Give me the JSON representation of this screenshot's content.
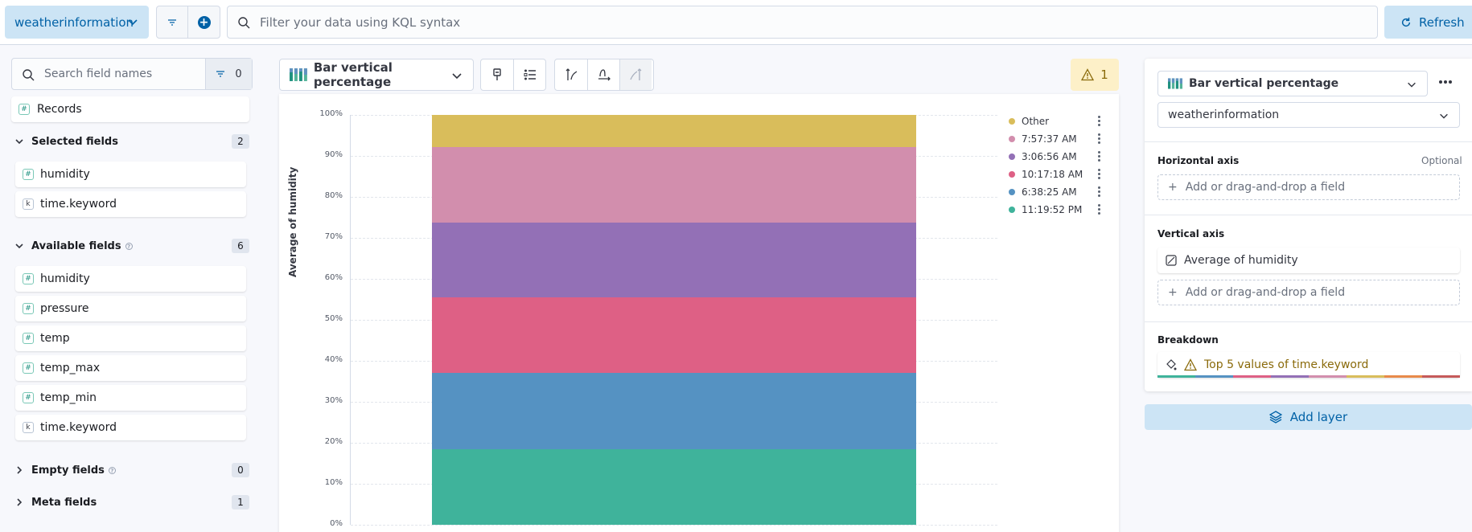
{
  "topbar": {
    "dataview": "weatherinformation",
    "query_placeholder": "Filter your data using KQL syntax",
    "refresh_label": "Refresh"
  },
  "sidebar": {
    "search_placeholder": "Search field names",
    "filter_count": "0",
    "records_label": "Records",
    "selected": {
      "title": "Selected fields",
      "count": "2",
      "items": [
        {
          "name": "humidity",
          "type": "#"
        },
        {
          "name": "time.keyword",
          "type": "k"
        }
      ]
    },
    "available": {
      "title": "Available fields",
      "count": "6",
      "items": [
        {
          "name": "humidity",
          "type": "#"
        },
        {
          "name": "pressure",
          "type": "#"
        },
        {
          "name": "temp",
          "type": "#"
        },
        {
          "name": "temp_max",
          "type": "#"
        },
        {
          "name": "temp_min",
          "type": "#"
        },
        {
          "name": "time.keyword",
          "type": "k"
        }
      ]
    },
    "empty": {
      "title": "Empty fields",
      "count": "0"
    },
    "meta": {
      "title": "Meta fields",
      "count": "1"
    }
  },
  "workspace": {
    "viz_type": "Bar vertical percentage",
    "warning_count": "1"
  },
  "chart_data": {
    "type": "bar",
    "stacked": "percentage",
    "categories": [
      ""
    ],
    "ylabel": "Average of humidity",
    "ylim": [
      0,
      100
    ],
    "y_ticks": [
      "100%",
      "90%",
      "80%",
      "70%",
      "60%",
      "50%",
      "40%",
      "30%",
      "20%",
      "10%",
      "0%"
    ],
    "grid": true,
    "legend_position": "right",
    "series": [
      {
        "name": "11:19:52 PM",
        "values": [
          18.5
        ],
        "color": "#3fb39b"
      },
      {
        "name": "6:38:25 AM",
        "values": [
          18.5
        ],
        "color": "#5592c2"
      },
      {
        "name": "10:17:18 AM",
        "values": [
          18.4
        ],
        "color": "#de6085"
      },
      {
        "name": "3:06:56 AM",
        "values": [
          18.4
        ],
        "color": "#9370b6"
      },
      {
        "name": "7:57:37 AM",
        "values": [
          18.4
        ],
        "color": "#d28ead"
      },
      {
        "name": "Other",
        "values": [
          7.8
        ],
        "color": "#d9bd5b"
      }
    ]
  },
  "config": {
    "viz_type": "Bar vertical percentage",
    "datasource": "weatherinformation",
    "horizontal_axis": {
      "label": "Horizontal axis",
      "optional": "Optional",
      "placeholder": "Add or drag-and-drop a field"
    },
    "vertical_axis": {
      "label": "Vertical axis",
      "value": "Average of humidity",
      "placeholder": "Add or drag-and-drop a field"
    },
    "breakdown": {
      "label": "Breakdown",
      "value": "Top 5 values of time.keyword"
    },
    "add_layer": "Add layer"
  }
}
